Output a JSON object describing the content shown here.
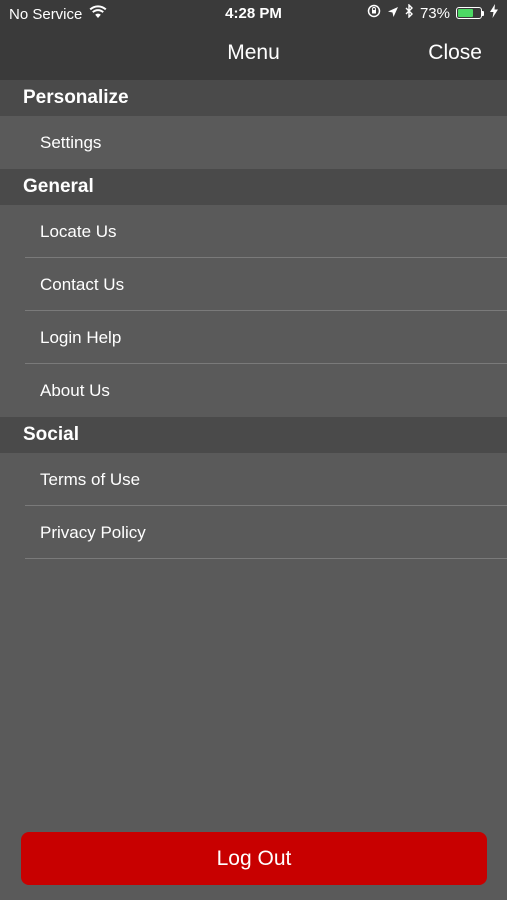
{
  "status_bar": {
    "carrier": "No Service",
    "time": "4:28 PM",
    "battery_percent": "73%",
    "battery_level": 0.73,
    "battery_color": "#4cd964"
  },
  "nav": {
    "title": "Menu",
    "close_label": "Close"
  },
  "sections": {
    "personalize": {
      "header": "Personalize",
      "items": [
        "Settings"
      ]
    },
    "general": {
      "header": "General",
      "items": [
        "Locate Us",
        "Contact Us",
        "Login Help",
        "About Us"
      ]
    },
    "social": {
      "header": "Social",
      "items": [
        "Terms of Use",
        "Privacy Policy"
      ]
    }
  },
  "logout": {
    "label": "Log Out",
    "color": "#c80000"
  },
  "icons": [
    "wifi-icon",
    "orientation-lock-icon",
    "location-icon",
    "bluetooth-icon",
    "battery-icon",
    "charging-icon"
  ]
}
